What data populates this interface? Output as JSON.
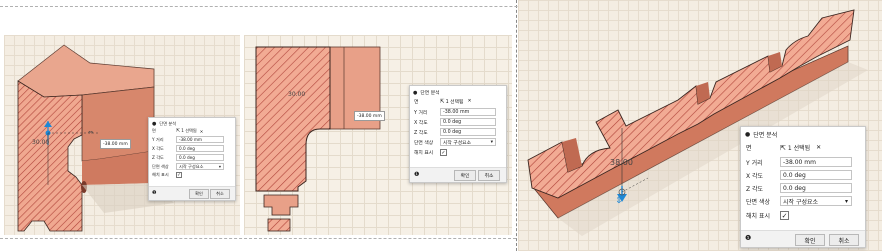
{
  "views": [
    {
      "dimension_text": "30.00",
      "distance_tag": "-38.00 mm",
      "dialog": {
        "title": "단면 분석",
        "face_label": "면",
        "face_value": "1 선택됨",
        "distance_label": "Y 거리",
        "distance_value": "-38.00 mm",
        "xangle_label": "X 각도",
        "xangle_value": "0.0 deg",
        "zangle_label": "Z 각도",
        "zangle_value": "0.0 deg",
        "color_label": "단면 색상",
        "color_value": "시작 구성요소",
        "hatch_label": "해치 표시",
        "ok_label": "확인",
        "cancel_label": "취소"
      }
    },
    {
      "dimension_text": "30.00",
      "distance_tag": "-38.00 mm",
      "dialog": {
        "title": "단면 분석",
        "face_label": "면",
        "face_value": "1 선택됨",
        "distance_label": "Y 거리",
        "distance_value": "-38.00 mm",
        "xangle_label": "X 각도",
        "xangle_value": "0.0 deg",
        "zangle_label": "Z 각도",
        "zangle_value": "0.0 deg",
        "color_label": "단면 색상",
        "color_value": "시작 구성요소",
        "hatch_label": "해치 표시",
        "ok_label": "확인",
        "cancel_label": "취소"
      }
    },
    {
      "dimension_text": "38.00",
      "dialog": {
        "title": "단면 분석",
        "face_label": "면",
        "face_value": "1 선택됨",
        "distance_label": "Y 거리",
        "distance_value": "-38.00 mm",
        "xangle_label": "X 각도",
        "xangle_value": "0.0 deg",
        "zangle_label": "Z 각도",
        "zangle_value": "0.0 deg",
        "color_label": "단면 색상",
        "color_value": "시작 구성요소",
        "hatch_label": "해치 표시",
        "ok_label": "확인",
        "cancel_label": "취소"
      }
    }
  ],
  "colors": {
    "part_fill": "#e8a088",
    "part_shade": "#cf7a60",
    "hatch": "#b0443a",
    "grid_bg": "#f4ede2",
    "accent": "#1e88d6"
  },
  "icons": [
    "cursor-icon",
    "close-icon",
    "chevron-down-icon",
    "check-icon",
    "info-icon",
    "manipulator-arrow-icon"
  ]
}
